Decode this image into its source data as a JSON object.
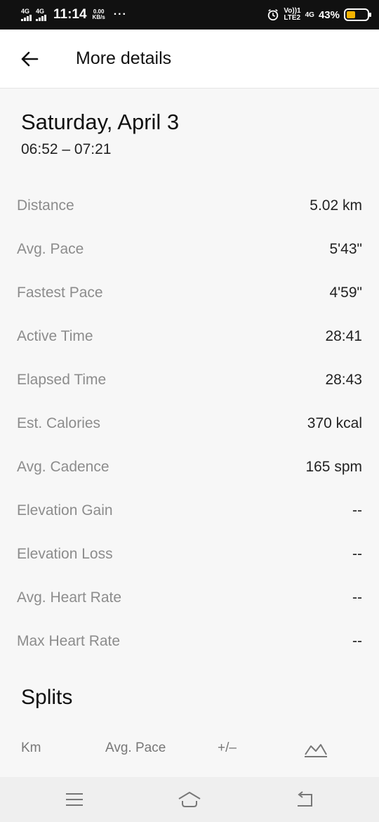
{
  "status_bar": {
    "network_1": "4G",
    "network_2": "4G",
    "time": "11:14",
    "speed_value": "0.00",
    "speed_unit": "KB/s",
    "more": "···",
    "volte_top": "Vo))1",
    "volte_bottom": "LTE2",
    "network_3": "4G",
    "battery_percent": "43%",
    "battery_level": 0.43,
    "battery_color": "#f5b400"
  },
  "app_bar": {
    "back_icon": "arrow-left-icon",
    "title": "More details"
  },
  "activity": {
    "date": "Saturday, April 3",
    "time_range": "06:52 – 07:21"
  },
  "stats": [
    {
      "label": "Distance",
      "value": "5.02 km"
    },
    {
      "label": "Avg. Pace",
      "value": "5'43\""
    },
    {
      "label": "Fastest Pace",
      "value": "4'59\""
    },
    {
      "label": "Active Time",
      "value": "28:41"
    },
    {
      "label": "Elapsed Time",
      "value": "28:43"
    },
    {
      "label": "Est. Calories",
      "value": "370 kcal"
    },
    {
      "label": "Avg. Cadence",
      "value": "165 spm"
    },
    {
      "label": "Elevation Gain",
      "value": "--"
    },
    {
      "label": "Elevation Loss",
      "value": "--"
    },
    {
      "label": "Avg. Heart Rate",
      "value": "--"
    },
    {
      "label": "Max Heart Rate",
      "value": "--"
    }
  ],
  "splits": {
    "title": "Splits",
    "col_km": "Km",
    "col_pace": "Avg. Pace",
    "col_diff": "+/–",
    "chart_icon": "elevation-chart-icon"
  },
  "nav_bar": {
    "menu_icon": "menu-icon",
    "home_icon": "home-icon",
    "back_icon": "back-icon"
  }
}
